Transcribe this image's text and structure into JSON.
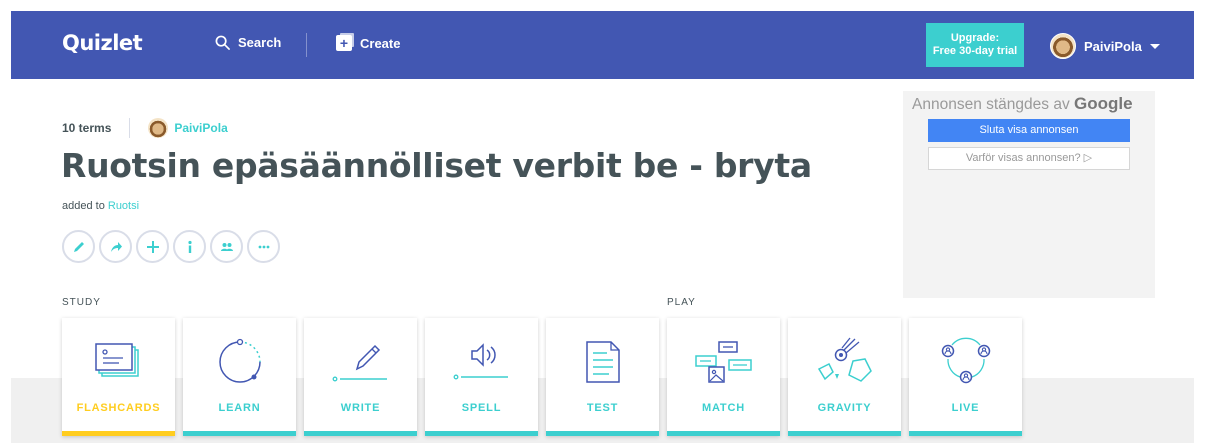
{
  "header": {
    "logo": "Quizlet",
    "search_label": "Search",
    "create_label": "Create",
    "upgrade_line1": "Upgrade:",
    "upgrade_line2": "Free 30-day trial",
    "username": "PaiviPola"
  },
  "set": {
    "term_count": "10 terms",
    "author": "PaiviPola",
    "title": "Ruotsin epäsäännölliset verbit be - bryta",
    "added_prefix": "added to ",
    "folder": "Ruotsi"
  },
  "actions": [
    {
      "name": "edit-icon"
    },
    {
      "name": "share-icon"
    },
    {
      "name": "add-icon"
    },
    {
      "name": "info-icon"
    },
    {
      "name": "people-icon"
    },
    {
      "name": "more-icon"
    }
  ],
  "ad": {
    "closed_text": "Annonsen stängdes av",
    "closed_brand": "Google",
    "stop_button": "Sluta visa annonsen",
    "why_button": "Varför visas annonsen? ▷"
  },
  "sections": {
    "study": "STUDY",
    "play": "PLAY"
  },
  "modes": [
    {
      "label": "FLASHCARDS",
      "icon": "flashcards-icon",
      "active": true
    },
    {
      "label": "LEARN",
      "icon": "learn-icon",
      "active": false
    },
    {
      "label": "WRITE",
      "icon": "write-icon",
      "active": false
    },
    {
      "label": "SPELL",
      "icon": "spell-icon",
      "active": false
    },
    {
      "label": "TEST",
      "icon": "test-icon",
      "active": false
    },
    {
      "label": "MATCH",
      "icon": "match-icon",
      "active": false
    },
    {
      "label": "GRAVITY",
      "icon": "gravity-icon",
      "active": false
    },
    {
      "label": "LIVE",
      "icon": "live-icon",
      "active": false
    }
  ],
  "colors": {
    "header_bg": "#4257b2",
    "accent": "#3ccfcf",
    "active": "#ffcd1f",
    "text": "#455358"
  }
}
